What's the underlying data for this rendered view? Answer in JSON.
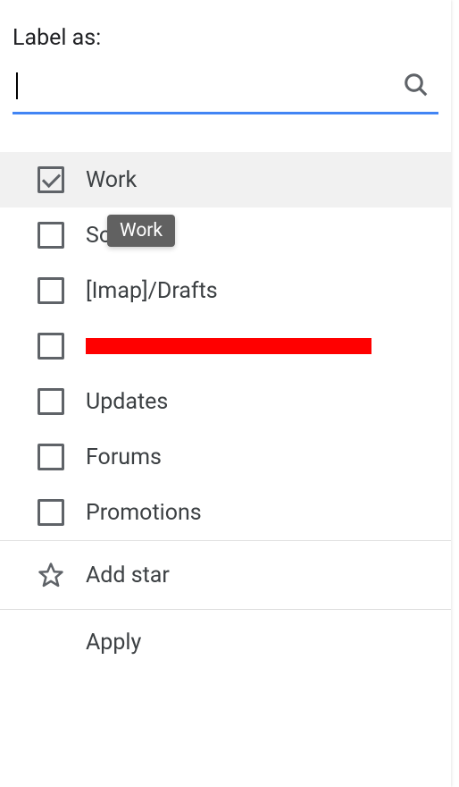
{
  "title": "Label as:",
  "search": {
    "value": "",
    "placeholder": ""
  },
  "tooltip": "Work",
  "labels": [
    {
      "text": "Work",
      "checked": true,
      "highlighted": true
    },
    {
      "text": "Social",
      "checked": false,
      "highlighted": false
    },
    {
      "text": "[Imap]/Drafts",
      "checked": false,
      "highlighted": false
    },
    {
      "text": "[redacted]",
      "checked": false,
      "highlighted": false,
      "redacted": true
    },
    {
      "text": "Updates",
      "checked": false,
      "highlighted": false
    },
    {
      "text": "Forums",
      "checked": false,
      "highlighted": false
    },
    {
      "text": "Promotions",
      "checked": false,
      "highlighted": false
    }
  ],
  "actions": {
    "add_star": "Add star",
    "apply": "Apply"
  }
}
